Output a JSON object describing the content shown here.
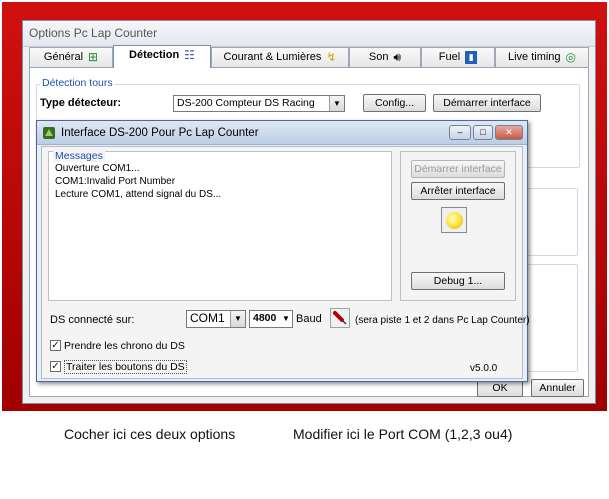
{
  "window": {
    "title": "Options Pc Lap Counter"
  },
  "tabs": [
    {
      "label": "Général",
      "icon": "grid-icon"
    },
    {
      "label": "Détection",
      "icon": "sensor-icon"
    },
    {
      "label": "Courant & Lumières",
      "icon": "lightning-icon"
    },
    {
      "label": "Son",
      "icon": "speaker-icon"
    },
    {
      "label": "Fuel",
      "icon": "fuel-icon"
    },
    {
      "label": "Live timing",
      "icon": "globe-icon"
    }
  ],
  "detection": {
    "group_label": "Détection tours",
    "type_label": "Type détecteur:",
    "type_value": "DS-200 Compteur DS Racing",
    "config_button": "Config...",
    "start_button": "Démarrer interface"
  },
  "footer": {
    "ok_button": "OK",
    "cancel_button": "Annuler"
  },
  "dialog": {
    "title": "Interface DS-200 Pour Pc Lap Counter",
    "messages_label": "Messages",
    "messages": [
      "Ouverture COM1...",
      "COM1:Invalid Port Number",
      "Lecture COM1, attend signal du DS..."
    ],
    "start_button": "Démarrer interface",
    "stop_button": "Arrêter interface",
    "debug_button": "Debug 1...",
    "ds_label": "DS connecté sur:",
    "com_value": "COM1",
    "baud_value": "4800",
    "baud_label": "Baud",
    "piste_note": "(sera piste 1 et 2 dans Pc Lap Counter)",
    "check_chrono": {
      "label": "Prendre les chrono du DS",
      "checked": true
    },
    "check_buttons": {
      "label": "Traiter les boutons du DS",
      "checked": true
    },
    "version": "v5.0.0"
  },
  "captions": {
    "left": "Cocher ici ces deux options",
    "right": "Modifier ici le Port COM (1,2,3 ou4)"
  },
  "colors": {
    "frame": "#c00000",
    "group_label": "#1f4fb0",
    "lamp": "#ffe740"
  }
}
